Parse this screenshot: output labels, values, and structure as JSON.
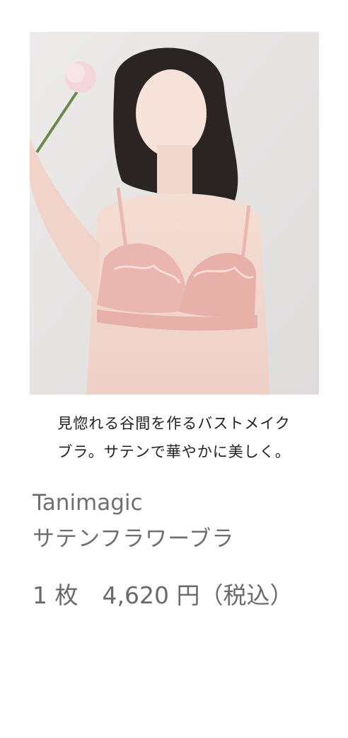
{
  "product": {
    "image_alt": "product-photo",
    "catch_copy": {
      "line1": "見惚れる谷間を作るバストメイク",
      "line2": "ブラ。サテンで華やかに美しく。"
    },
    "brand": "Tanimagic",
    "name": "サテンフラワーブラ",
    "quantity": "1 枚",
    "price": "4,620 円（税込）"
  },
  "colors": {
    "background": "#ffffff",
    "text_dark": "#222222",
    "text_gray": "#6f6f6f",
    "bra_pink": "#eab7b0",
    "photo_bg": "#e9e7e6"
  }
}
